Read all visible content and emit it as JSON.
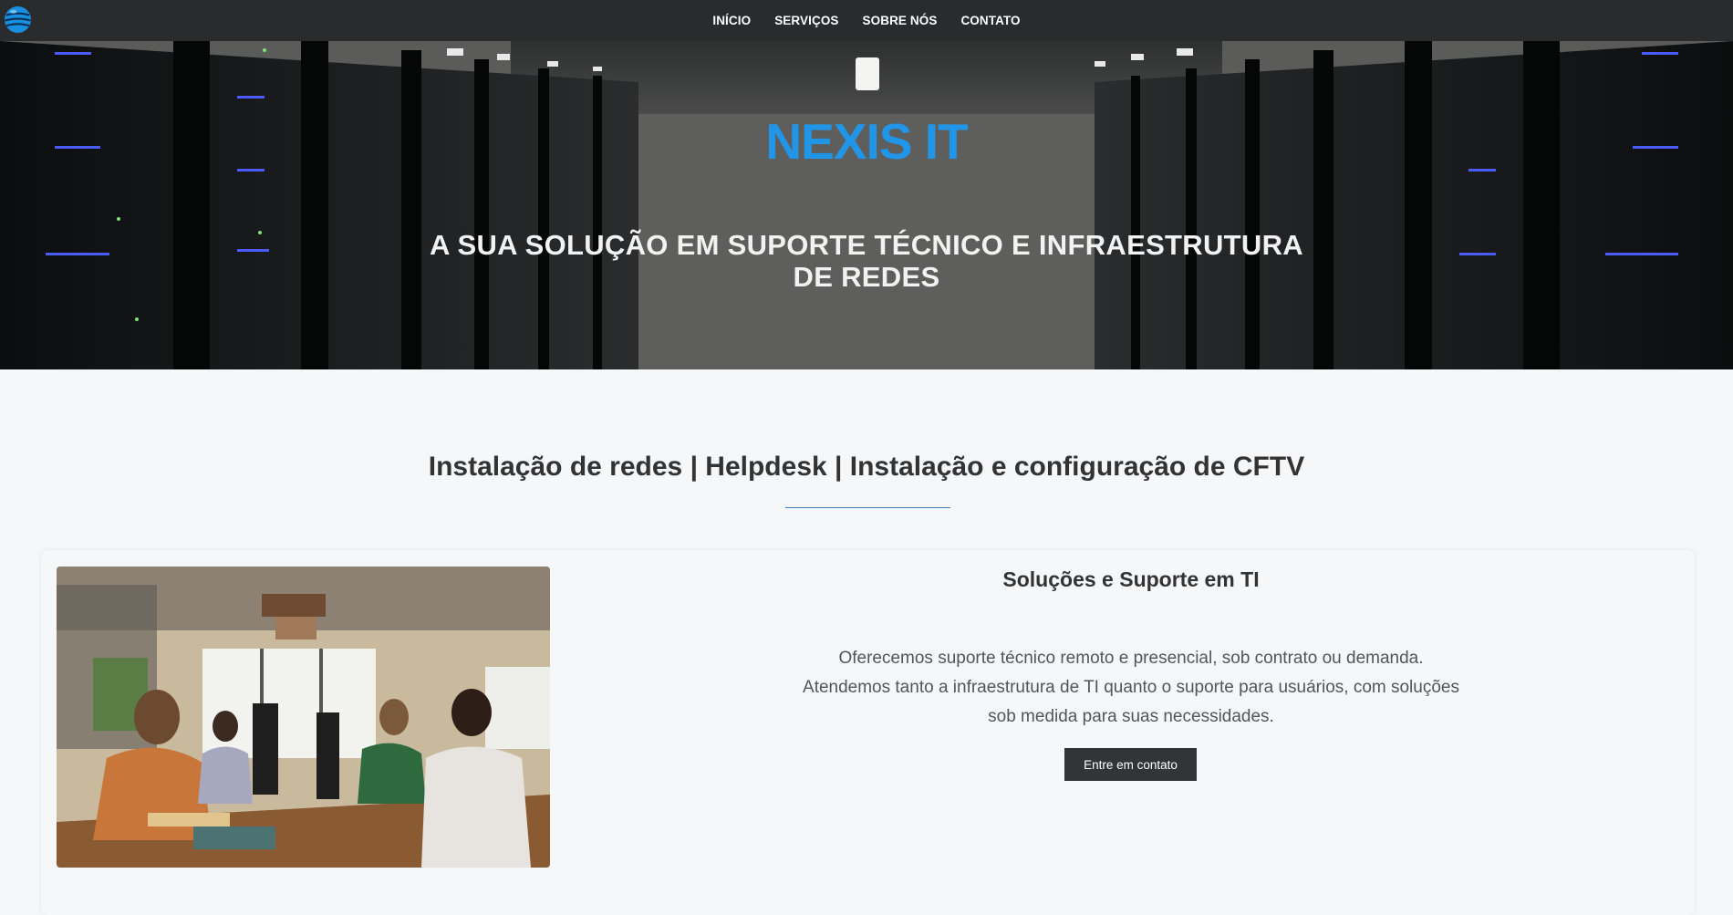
{
  "nav": {
    "items": [
      {
        "label": "INÍCIO"
      },
      {
        "label": "SERVIÇOS"
      },
      {
        "label": "SOBRE NÓS"
      },
      {
        "label": "CONTATO"
      }
    ],
    "logo_icon": "globe-logo-icon"
  },
  "hero": {
    "title": "NEXIS IT",
    "subtitle": "A SUA SOLUÇÃO EM SUPORTE TÉCNICO E INFRAESTRUTURA DE REDES"
  },
  "services": {
    "heading": "Instalação de redes | Helpdesk | Instalação e configuração de CFTV"
  },
  "card": {
    "title": "Soluções e Suporte em TI",
    "text": "Oferecemos suporte técnico remoto e presencial, sob contrato ou demanda. Atendemos tanto a infraestrutura de TI quanto o suporte para usuários, com soluções sob medida para suas necessidades.",
    "button_label": "Entre em contato"
  },
  "colors": {
    "navbar": "#2a2b2d",
    "brand_blue": "#2196e8",
    "page_bg": "#f6f7f9",
    "button": "#333435"
  }
}
